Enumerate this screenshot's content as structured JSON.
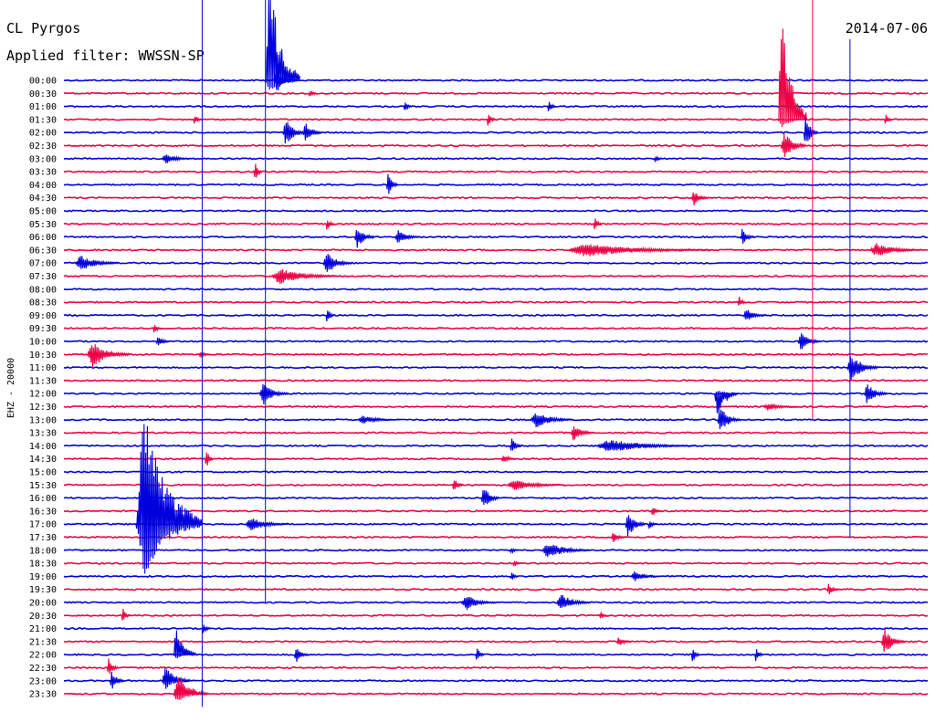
{
  "header": {
    "station": "CL Pyrgos",
    "filter": "Applied filter: WWSSN-SP",
    "date": "2014-07-06"
  },
  "chart_data": {
    "type": "line",
    "title": "CL Pyrgos",
    "subtitle": "Applied filter: WWSSN-SP",
    "date": "2014-07-06",
    "ylabel": "EHZ - 20000",
    "grid": false,
    "row_labels": [
      "00:00",
      "00:30",
      "01:00",
      "01:30",
      "02:00",
      "02:30",
      "03:00",
      "03:30",
      "04:00",
      "04:30",
      "05:00",
      "05:30",
      "06:00",
      "06:30",
      "07:00",
      "07:30",
      "08:00",
      "08:30",
      "09:00",
      "09:30",
      "10:00",
      "10:30",
      "11:00",
      "11:30",
      "12:00",
      "12:30",
      "13:00",
      "13:30",
      "14:00",
      "14:30",
      "15:00",
      "15:30",
      "16:00",
      "16:30",
      "17:00",
      "17:30",
      "18:00",
      "18:30",
      "19:00",
      "19:30",
      "20:00",
      "20:30",
      "21:00",
      "21:30",
      "22:00",
      "22:30",
      "23:00",
      "23:30"
    ],
    "colors": {
      "even_rows": "#0000dd",
      "odd_rows": "#ee0044"
    },
    "minutes_per_row": 30,
    "events": [
      {
        "row": 0,
        "minute": 7.0,
        "amp": 1.0,
        "dur": 1.2,
        "spike": true,
        "ext_up": 120,
        "ext_down": 15
      },
      {
        "row": 0,
        "minute": 7.3,
        "amp": 0.9,
        "dur": 0.8
      },
      {
        "row": 1,
        "minute": 8.5,
        "amp": 0.4,
        "dur": 0.3
      },
      {
        "row": 2,
        "minute": 11.8,
        "amp": 0.4,
        "dur": 0.3
      },
      {
        "row": 2,
        "minute": 16.8,
        "amp": 0.5,
        "dur": 0.3
      },
      {
        "row": 3,
        "minute": 4.5,
        "amp": 0.4,
        "dur": 0.3
      },
      {
        "row": 3,
        "minute": 14.7,
        "amp": 0.6,
        "dur": 0.3
      },
      {
        "row": 3,
        "minute": 24.8,
        "amp": 1.0,
        "dur": 1.0,
        "spike": true,
        "ext_up": 140,
        "ext_down": 10
      },
      {
        "row": 3,
        "minute": 28.5,
        "amp": 0.4,
        "dur": 0.3
      },
      {
        "row": 4,
        "minute": 7.6,
        "amp": 1.0,
        "dur": 0.8
      },
      {
        "row": 4,
        "minute": 8.3,
        "amp": 0.8,
        "dur": 0.7
      },
      {
        "row": 4,
        "minute": 25.7,
        "amp": 0.9,
        "dur": 0.5,
        "ext_up": 20,
        "ext_down": 20
      },
      {
        "row": 5,
        "minute": 24.9,
        "amp": 1.0,
        "dur": 0.9
      },
      {
        "row": 6,
        "minute": 3.4,
        "amp": 0.4,
        "dur": 1.0
      },
      {
        "row": 6,
        "minute": 20.5,
        "amp": 0.3,
        "dur": 0.3
      },
      {
        "row": 7,
        "minute": 6.6,
        "amp": 0.8,
        "dur": 0.3
      },
      {
        "row": 8,
        "minute": 11.2,
        "amp": 0.9,
        "dur": 0.4
      },
      {
        "row": 9,
        "minute": 21.8,
        "amp": 0.6,
        "dur": 0.6
      },
      {
        "row": 11,
        "minute": 9.1,
        "amp": 0.5,
        "dur": 0.3
      },
      {
        "row": 11,
        "minute": 18.4,
        "amp": 0.5,
        "dur": 0.3
      },
      {
        "row": 12,
        "minute": 10.1,
        "amp": 0.9,
        "dur": 0.7
      },
      {
        "row": 12,
        "minute": 11.5,
        "amp": 0.5,
        "dur": 0.9
      },
      {
        "row": 12,
        "minute": 23.5,
        "amp": 0.6,
        "dur": 0.5
      },
      {
        "row": 13,
        "minute": 17.5,
        "amp": 0.5,
        "dur": 5.0
      },
      {
        "row": 13,
        "minute": 28.0,
        "amp": 0.5,
        "dur": 1.8
      },
      {
        "row": 14,
        "minute": 0.4,
        "amp": 0.6,
        "dur": 1.5
      },
      {
        "row": 14,
        "minute": 9.0,
        "amp": 0.8,
        "dur": 1.0
      },
      {
        "row": 15,
        "minute": 7.2,
        "amp": 0.6,
        "dur": 2.3
      },
      {
        "row": 17,
        "minute": 23.4,
        "amp": 0.5,
        "dur": 0.3
      },
      {
        "row": 18,
        "minute": 9.1,
        "amp": 0.6,
        "dur": 0.3
      },
      {
        "row": 18,
        "minute": 23.6,
        "amp": 0.5,
        "dur": 0.8
      },
      {
        "row": 19,
        "minute": 3.1,
        "amp": 0.4,
        "dur": 0.3
      },
      {
        "row": 20,
        "minute": 3.2,
        "amp": 0.4,
        "dur": 0.5
      },
      {
        "row": 20,
        "minute": 25.5,
        "amp": 0.7,
        "dur": 0.8
      },
      {
        "row": 21,
        "minute": 0.8,
        "amp": 1.0,
        "dur": 1.5
      },
      {
        "row": 21,
        "minute": 4.7,
        "amp": 0.3,
        "dur": 0.4
      },
      {
        "row": 22,
        "minute": 27.2,
        "amp": 1.0,
        "dur": 1.1
      },
      {
        "row": 24,
        "minute": 6.8,
        "amp": 0.8,
        "dur": 1.0
      },
      {
        "row": 24,
        "minute": 22.6,
        "amp": 1.0,
        "dur": 0.8,
        "ext_up": 5,
        "ext_down": 30
      },
      {
        "row": 24,
        "minute": 27.8,
        "amp": 0.8,
        "dur": 0.8
      },
      {
        "row": 25,
        "minute": 24.3,
        "amp": 0.3,
        "dur": 1.2
      },
      {
        "row": 26,
        "minute": 10.2,
        "amp": 0.3,
        "dur": 1.5
      },
      {
        "row": 26,
        "minute": 16.2,
        "amp": 0.6,
        "dur": 1.5
      },
      {
        "row": 26,
        "minute": 22.7,
        "amp": 1.0,
        "dur": 0.8
      },
      {
        "row": 27,
        "minute": 17.6,
        "amp": 0.6,
        "dur": 0.8
      },
      {
        "row": 28,
        "minute": 15.5,
        "amp": 0.7,
        "dur": 0.4
      },
      {
        "row": 28,
        "minute": 18.5,
        "amp": 0.5,
        "dur": 3.5
      },
      {
        "row": 29,
        "minute": 4.9,
        "amp": 0.8,
        "dur": 0.3
      },
      {
        "row": 29,
        "minute": 15.2,
        "amp": 0.4,
        "dur": 0.5
      },
      {
        "row": 31,
        "minute": 13.5,
        "amp": 0.6,
        "dur": 0.4
      },
      {
        "row": 31,
        "minute": 15.4,
        "amp": 0.4,
        "dur": 2.0
      },
      {
        "row": 32,
        "minute": 14.5,
        "amp": 1.0,
        "dur": 0.6
      },
      {
        "row": 33,
        "minute": 20.4,
        "amp": 0.4,
        "dur": 0.4
      },
      {
        "row": 34,
        "minute": 2.5,
        "amp": 1.0,
        "dur": 2.3,
        "ext_up": 130,
        "ext_down": 60
      },
      {
        "row": 34,
        "minute": 6.3,
        "amp": 0.5,
        "dur": 1.5
      },
      {
        "row": 34,
        "minute": 19.5,
        "amp": 1.0,
        "dur": 0.7
      },
      {
        "row": 34,
        "minute": 20.3,
        "amp": 0.4,
        "dur": 0.3
      },
      {
        "row": 35,
        "minute": 19.0,
        "amp": 0.4,
        "dur": 0.6
      },
      {
        "row": 36,
        "minute": 15.5,
        "amp": 0.3,
        "dur": 0.3
      },
      {
        "row": 36,
        "minute": 16.6,
        "amp": 0.6,
        "dur": 1.7
      },
      {
        "row": 37,
        "minute": 15.6,
        "amp": 0.3,
        "dur": 0.3
      },
      {
        "row": 38,
        "minute": 15.5,
        "amp": 0.4,
        "dur": 0.3
      },
      {
        "row": 38,
        "minute": 19.7,
        "amp": 0.4,
        "dur": 1.0
      },
      {
        "row": 39,
        "minute": 26.5,
        "amp": 0.4,
        "dur": 0.5
      },
      {
        "row": 40,
        "minute": 13.8,
        "amp": 0.6,
        "dur": 1.2
      },
      {
        "row": 40,
        "minute": 17.1,
        "amp": 0.7,
        "dur": 1.2
      },
      {
        "row": 41,
        "minute": 2.0,
        "amp": 0.6,
        "dur": 0.3
      },
      {
        "row": 41,
        "minute": 18.6,
        "amp": 0.3,
        "dur": 0.3
      },
      {
        "row": 42,
        "minute": 4.8,
        "amp": 0.4,
        "dur": 0.3
      },
      {
        "row": 43,
        "minute": 28.4,
        "amp": 1.0,
        "dur": 0.8
      },
      {
        "row": 43,
        "minute": 19.2,
        "amp": 0.4,
        "dur": 0.5
      },
      {
        "row": 44,
        "minute": 3.8,
        "amp": 1.0,
        "dur": 0.8,
        "ext_up": 35,
        "ext_down": 5
      },
      {
        "row": 44,
        "minute": 8.0,
        "amp": 0.6,
        "dur": 0.5
      },
      {
        "row": 44,
        "minute": 14.3,
        "amp": 0.7,
        "dur": 0.3
      },
      {
        "row": 44,
        "minute": 21.8,
        "amp": 0.6,
        "dur": 0.3
      },
      {
        "row": 44,
        "minute": 24.0,
        "amp": 0.6,
        "dur": 0.3
      },
      {
        "row": 45,
        "minute": 1.5,
        "amp": 0.7,
        "dur": 0.4
      },
      {
        "row": 46,
        "minute": 1.6,
        "amp": 0.8,
        "dur": 0.5
      },
      {
        "row": 46,
        "minute": 3.4,
        "amp": 1.0,
        "dur": 1.0,
        "ext_up": 20,
        "ext_down": 10
      },
      {
        "row": 47,
        "minute": 3.8,
        "amp": 1.0,
        "dur": 1.2,
        "ext_up": 25,
        "ext_down": 10
      }
    ],
    "vertical_marks": [
      {
        "minute": 4.8,
        "row_from": 0,
        "row_to": 48,
        "color": "#0000dd"
      },
      {
        "minute": 7.0,
        "row_from": 0,
        "row_to": 40,
        "color": "#0000dd"
      },
      {
        "minute": 26.0,
        "row_from": 0,
        "row_to": 26,
        "color": "#ee0044"
      },
      {
        "minute": 27.3,
        "row_from": 3,
        "row_to": 35,
        "color": "#0000dd"
      }
    ]
  }
}
